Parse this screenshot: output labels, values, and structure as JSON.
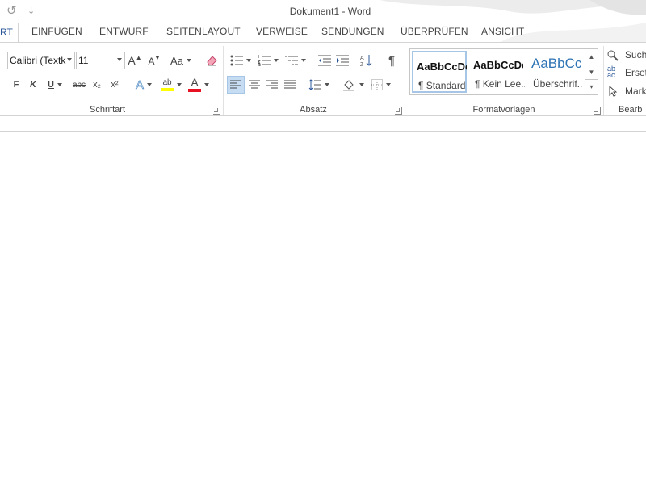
{
  "titlebar": {
    "quick_access": [
      {
        "name": "redo-icon",
        "glyph": "↺"
      },
      {
        "name": "customize-quick-access-icon",
        "glyph": "⇣"
      }
    ],
    "title": "Dokument1 - Word",
    "help": "?"
  },
  "tabs": [
    {
      "label": "RT",
      "active": true
    },
    {
      "label": "EINFÜGEN"
    },
    {
      "label": "ENTWURF"
    },
    {
      "label": "SEITENLAYOUT"
    },
    {
      "label": "VERWEISE"
    },
    {
      "label": "SENDUNGEN"
    },
    {
      "label": "ÜBERPRÜFEN"
    },
    {
      "label": "ANSICHT"
    }
  ],
  "font_group": {
    "label": "Schriftart",
    "font_name": "Calibri (Textk",
    "font_size": "11",
    "grow_font": "A",
    "shrink_font": "A",
    "change_case": "Aa",
    "bold": "F",
    "italic": "K",
    "underline": "U",
    "strikethrough": "abc",
    "subscript": "x₂",
    "superscript": "x²",
    "text_effects": "A",
    "highlight": "ab",
    "font_color": "A",
    "highlight_color": "#ffff00",
    "font_color_value": "#e81123"
  },
  "paragraph_group": {
    "label": "Absatz",
    "pilcrow": "¶"
  },
  "styles_group": {
    "label": "Formatvorlagen",
    "items": [
      {
        "sample": "AaBbCcDc",
        "name": "¶ Standard",
        "selected": true
      },
      {
        "sample": "AaBbCcDc",
        "name": "¶ Kein Lee..."
      },
      {
        "sample": "AaBbCc",
        "name": "Überschrif..."
      }
    ],
    "heading_color": "#2e74b5"
  },
  "edit_group": {
    "label": "Bearb",
    "find": "Such",
    "replace": "Erset",
    "select": "Mark"
  },
  "colors": {
    "accent": "#2b579a",
    "selected_fill": "#c5dcf2"
  }
}
